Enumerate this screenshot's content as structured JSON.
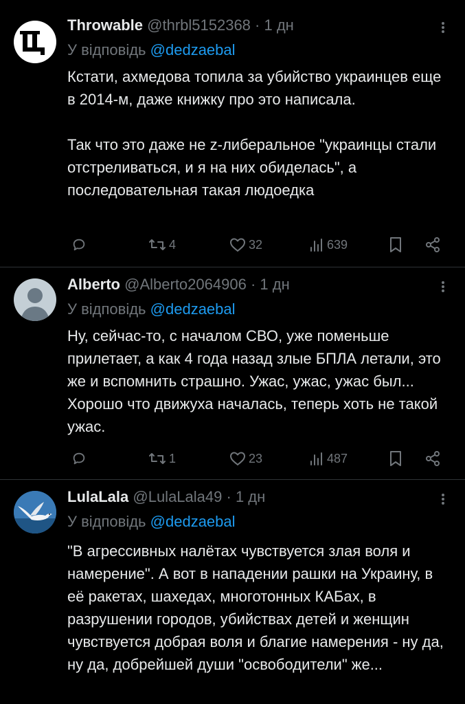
{
  "colors": {
    "background": "#000000",
    "text": "#e7e9ea",
    "muted": "#71767b",
    "link": "#1d9bf0",
    "divider": "#2f3336"
  },
  "tweets": [
    {
      "name": "Throwable",
      "handle": "@thrbl5152368",
      "time": "1 дн",
      "reply_prefix": "У відповідь",
      "reply_to": "@dedzaebal",
      "paragraphs": [
        "Кстати, ахмедова топила за убийство украинцев еще в 2014-м, даже книжку про это написала.",
        "Так что это даже не z-либеральное \"украинцы стали отстреливаться, и я на них обиделась\", а последовательная такая людоедка"
      ],
      "retweets": "4",
      "likes": "32",
      "views": "639",
      "avatar_icon": "throwable-logo-icon"
    },
    {
      "name": "Alberto",
      "handle": "@Alberto2064906",
      "time": "1 дн",
      "reply_prefix": "У відповідь",
      "reply_to": "@dedzaebal",
      "paragraphs": [
        "Ну, сейчас-то, с началом СВО, уже поменьше прилетает, а как 4 года назад злые БПЛА летали, это же и вспомнить страшно. Ужас, ужас, ужас был... Хорошо что движуха началась, теперь хоть не такой ужас."
      ],
      "retweets": "1",
      "likes": "23",
      "views": "487",
      "avatar_icon": "default-user-icon"
    },
    {
      "name": "LulaLala",
      "handle": "@LulaLala49",
      "time": "1 дн",
      "reply_prefix": "У відповідь",
      "reply_to": "@dedzaebal",
      "paragraphs": [
        "\"В агрессивных налётах чувствуется злая воля и намерение\". А вот в нападении рашки на Украину, в её ракетах, шахедах, многотонных КАБах, в разрушении городов, убийствах детей и женщин чувствуется добрая воля и благие намерения - ну да, ну да, добрейшей души \"освободители\" же..."
      ],
      "avatar_icon": "seagull-photo-icon"
    }
  ]
}
